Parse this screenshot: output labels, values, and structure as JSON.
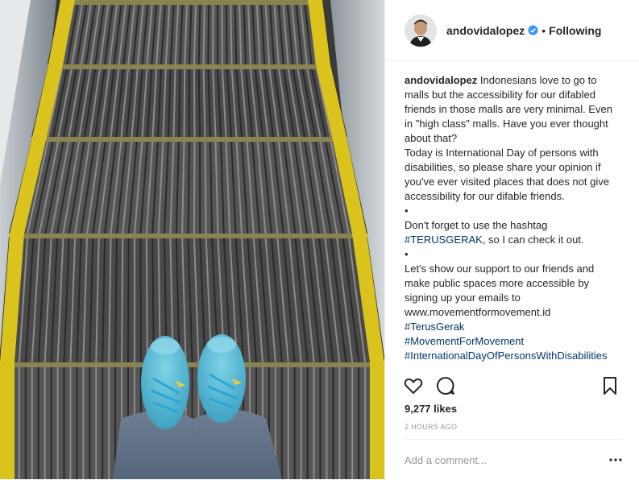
{
  "header": {
    "username": "andovidalopez",
    "separator": "•",
    "follow_label": "Following"
  },
  "caption": {
    "username": "andovidalopez",
    "lines": [
      "Indonesians love to go to malls but the accessibility for our difabled friends in those malls are very minimal. Even in \"high class\" malls. Have you ever thought about that?",
      "Today is International Day of persons with disabilities, so please share your opinion if you've ever visited places that does not give accessibility for our difable friends.",
      "•",
      "Don't forget to use the hashtag",
      "#TERUSGERAK",
      ", so I can check it out.",
      "•",
      "Let's show our support to our friends and make public spaces more accessible by signing up your emails to www.movementformovement.id",
      "#TerusGerak",
      "#MovementForMovement",
      "#InternationalDayOfPersonsWithDisabilities"
    ]
  },
  "actions": {
    "like_icon": "heart-icon",
    "comment_icon": "comment-icon",
    "save_icon": "bookmark-icon"
  },
  "stats": {
    "likes": "9,277 likes",
    "time": "2 HOURS AGO"
  },
  "comment": {
    "placeholder": "Add a comment...",
    "more_icon": "ellipsis-icon"
  },
  "colors": {
    "text": "#262626",
    "muted": "#999999",
    "hashtag": "#003569",
    "verified": "#3897f0",
    "divider": "#efefef"
  }
}
